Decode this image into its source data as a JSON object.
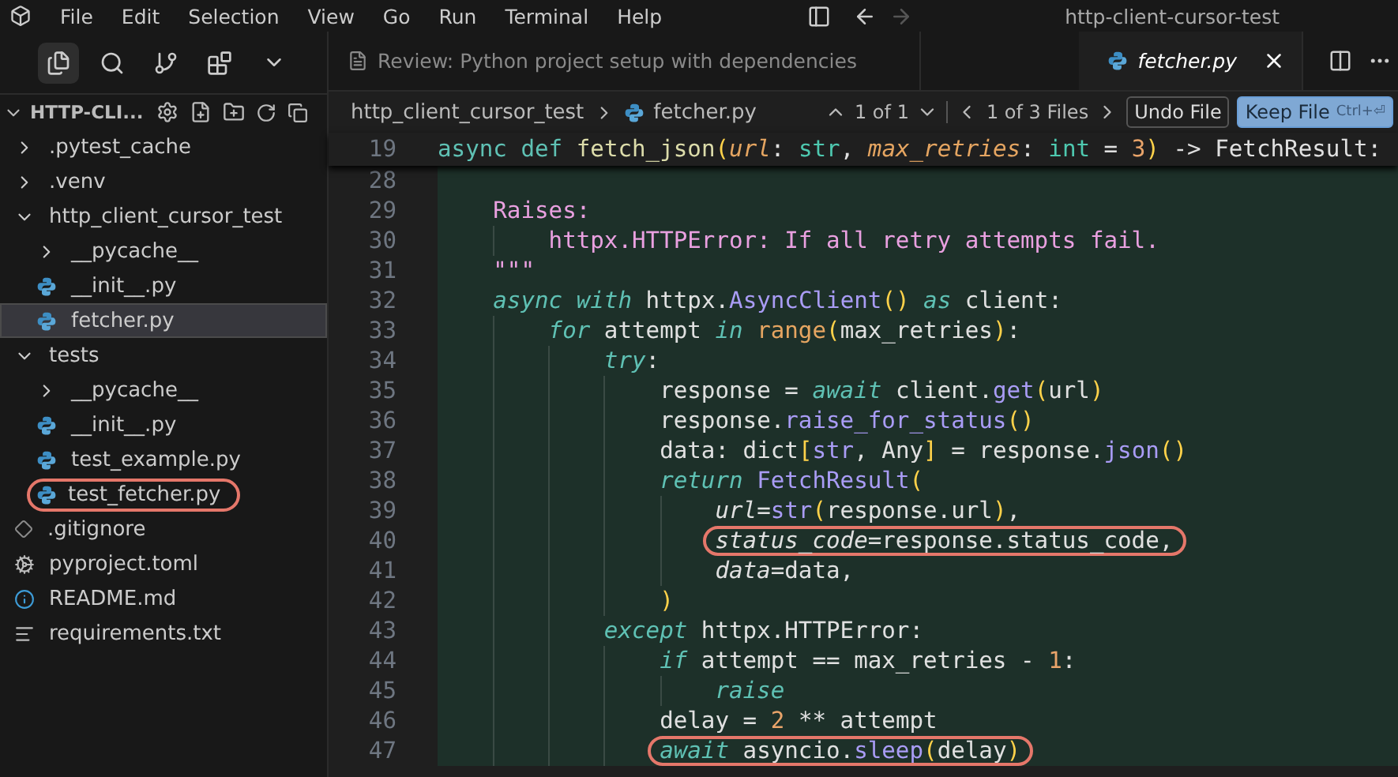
{
  "menu": [
    "File",
    "Edit",
    "Selection",
    "View",
    "Go",
    "Run",
    "Terminal",
    "Help"
  ],
  "window": {
    "title": "http-client-cursor-test"
  },
  "explorer": {
    "title": "HTTP-CLI...",
    "items": [
      {
        "label": ".pytest_cache",
        "kind": "folder",
        "expanded": false,
        "selected": false,
        "circled": false
      },
      {
        "label": ".venv",
        "kind": "folder",
        "expanded": false,
        "selected": false,
        "circled": false
      },
      {
        "label": "http_client_cursor_test",
        "kind": "folder",
        "expanded": true,
        "selected": false,
        "circled": false,
        "children": [
          {
            "label": "__pycache__",
            "kind": "folder",
            "expanded": false,
            "selected": false,
            "circled": false
          },
          {
            "label": "__init__.py",
            "kind": "python",
            "selected": false,
            "circled": false
          },
          {
            "label": "fetcher.py",
            "kind": "python",
            "selected": true,
            "circled": false
          }
        ]
      },
      {
        "label": "tests",
        "kind": "folder",
        "expanded": true,
        "selected": false,
        "circled": false,
        "children": [
          {
            "label": "__pycache__",
            "kind": "folder",
            "expanded": false,
            "selected": false,
            "circled": false
          },
          {
            "label": "__init__.py",
            "kind": "python",
            "selected": false,
            "circled": false
          },
          {
            "label": "test_example.py",
            "kind": "python",
            "selected": false,
            "circled": false
          },
          {
            "label": "test_fetcher.py",
            "kind": "python",
            "selected": false,
            "circled": true
          }
        ]
      },
      {
        "label": ".gitignore",
        "kind": "git",
        "selected": false,
        "circled": false
      },
      {
        "label": "pyproject.toml",
        "kind": "config",
        "selected": false,
        "circled": false
      },
      {
        "label": "README.md",
        "kind": "info",
        "selected": false,
        "circled": false
      },
      {
        "label": "requirements.txt",
        "kind": "text",
        "selected": false,
        "circled": false
      }
    ]
  },
  "tabs": [
    {
      "label": "Review: Python project setup with dependencies",
      "kind": "review",
      "selected": false
    },
    {
      "label": "fetcher.py",
      "kind": "python",
      "selected": true
    }
  ],
  "breadcrumb": [
    "http_client_cursor_test",
    "fetcher.py"
  ],
  "diff_nav": {
    "changes": "1 of 1",
    "files": "1 of 3 Files",
    "undo": "Undo File",
    "keep": "Keep File",
    "keep_shortcut": "Ctrl+⏎"
  },
  "sticky_line": {
    "number": "19",
    "tokens": [
      {
        "kind": "storage",
        "text": "async def "
      },
      {
        "kind": "fn",
        "text": "fetch_json"
      },
      {
        "kind": "paren",
        "text": "("
      },
      {
        "kind": "param",
        "text": "url"
      },
      {
        "kind": "plain",
        "text": ": "
      },
      {
        "kind": "type",
        "text": "str"
      },
      {
        "kind": "plain",
        "text": ", "
      },
      {
        "kind": "param",
        "text": "max_retries"
      },
      {
        "kind": "plain",
        "text": ": "
      },
      {
        "kind": "type",
        "text": "int"
      },
      {
        "kind": "plain",
        "text": " = "
      },
      {
        "kind": "num",
        "text": "3"
      },
      {
        "kind": "paren",
        "text": ")"
      },
      {
        "kind": "plain",
        "text": " -> FetchResult:"
      }
    ]
  },
  "lines": [
    {
      "number": "28"
    },
    {
      "number": "29",
      "circled": false,
      "tokens": [
        {
          "kind": "doc",
          "text": "Raises:"
        }
      ],
      "children": [
        {
          "number": "30",
          "circled": false,
          "tokens": [
            {
              "kind": "doc",
              "text": "httpx.HTTPError: If all retry attempts fail."
            }
          ]
        }
      ]
    },
    {
      "number": "31",
      "circled": false,
      "tokens": [
        {
          "kind": "doc",
          "text": "\"\"\""
        }
      ]
    },
    {
      "number": "32",
      "circled": false,
      "tokens": [
        {
          "kind": "kwi",
          "text": "async with"
        },
        {
          "kind": "plain",
          "text": " httpx."
        },
        {
          "kind": "method",
          "text": "AsyncClient"
        },
        {
          "kind": "paren",
          "text": "() "
        },
        {
          "kind": "kwi",
          "text": "as"
        },
        {
          "kind": "plain",
          "text": " client:"
        }
      ],
      "children": [
        {
          "number": "33",
          "circled": false,
          "tokens": [
            {
              "kind": "kwi",
              "text": "for"
            },
            {
              "kind": "plain",
              "text": " attempt "
            },
            {
              "kind": "kwi",
              "text": "in "
            },
            {
              "kind": "builtin",
              "text": "range"
            },
            {
              "kind": "paren",
              "text": "("
            },
            {
              "kind": "plain",
              "text": "max_retries"
            },
            {
              "kind": "paren",
              "text": ")"
            },
            {
              "kind": "plain",
              "text": ":"
            }
          ],
          "children": [
            {
              "number": "34",
              "circled": false,
              "tokens": [
                {
                  "kind": "kwi",
                  "text": "try"
                },
                {
                  "kind": "plain",
                  "text": ":"
                }
              ],
              "children": [
                {
                  "number": "35",
                  "circled": false,
                  "tokens": [
                    {
                      "kind": "plain",
                      "text": "response = "
                    },
                    {
                      "kind": "kwi",
                      "text": "await"
                    },
                    {
                      "kind": "plain",
                      "text": " client."
                    },
                    {
                      "kind": "method",
                      "text": "get"
                    },
                    {
                      "kind": "paren",
                      "text": "("
                    },
                    {
                      "kind": "plain",
                      "text": "url"
                    },
                    {
                      "kind": "paren",
                      "text": ")"
                    }
                  ]
                },
                {
                  "number": "36",
                  "circled": false,
                  "tokens": [
                    {
                      "kind": "plain",
                      "text": "response."
                    },
                    {
                      "kind": "method",
                      "text": "raise_for_status"
                    },
                    {
                      "kind": "paren",
                      "text": "()"
                    }
                  ]
                },
                {
                  "number": "37",
                  "circled": false,
                  "tokens": [
                    {
                      "kind": "plain",
                      "text": "data: dict"
                    },
                    {
                      "kind": "paren",
                      "text": "["
                    },
                    {
                      "kind": "method",
                      "text": "str"
                    },
                    {
                      "kind": "plain",
                      "text": ", Any"
                    },
                    {
                      "kind": "paren",
                      "text": "]"
                    },
                    {
                      "kind": "plain",
                      "text": " = response."
                    },
                    {
                      "kind": "method",
                      "text": "json"
                    },
                    {
                      "kind": "paren",
                      "text": "()"
                    }
                  ]
                },
                {
                  "number": "38",
                  "circled": false,
                  "tokens": [
                    {
                      "kind": "kwi",
                      "text": "return "
                    },
                    {
                      "kind": "method",
                      "text": "FetchResult"
                    },
                    {
                      "kind": "paren",
                      "text": "("
                    }
                  ],
                  "children": [
                    {
                      "number": "39",
                      "circled": false,
                      "tokens": [
                        {
                          "kind": "arg",
                          "text": "url"
                        },
                        {
                          "kind": "plain",
                          "text": "="
                        },
                        {
                          "kind": "method",
                          "text": "str"
                        },
                        {
                          "kind": "paren",
                          "text": "("
                        },
                        {
                          "kind": "plain",
                          "text": "response.url"
                        },
                        {
                          "kind": "paren",
                          "text": ")"
                        },
                        {
                          "kind": "plain",
                          "text": ","
                        }
                      ]
                    },
                    {
                      "number": "40",
                      "circled": true,
                      "tokens": [
                        {
                          "kind": "arg",
                          "text": "status_code"
                        },
                        {
                          "kind": "plain",
                          "text": "=response.status_code,"
                        }
                      ]
                    },
                    {
                      "number": "41",
                      "circled": false,
                      "tokens": [
                        {
                          "kind": "arg",
                          "text": "data"
                        },
                        {
                          "kind": "plain",
                          "text": "=data,"
                        }
                      ]
                    }
                  ]
                },
                {
                  "number": "42",
                  "circled": false,
                  "tokens": [
                    {
                      "kind": "paren",
                      "text": ")"
                    }
                  ]
                }
              ]
            },
            {
              "number": "43",
              "circled": false,
              "tokens": [
                {
                  "kind": "kwi",
                  "text": "except"
                },
                {
                  "kind": "plain",
                  "text": " httpx.HTTPError:"
                }
              ],
              "children": [
                {
                  "number": "44",
                  "circled": false,
                  "tokens": [
                    {
                      "kind": "kwi",
                      "text": "if"
                    },
                    {
                      "kind": "plain",
                      "text": " attempt == max_retries - "
                    },
                    {
                      "kind": "num",
                      "text": "1"
                    },
                    {
                      "kind": "plain",
                      "text": ":"
                    }
                  ],
                  "children": [
                    {
                      "number": "45",
                      "circled": false,
                      "tokens": [
                        {
                          "kind": "kwi",
                          "text": "raise"
                        }
                      ]
                    }
                  ]
                },
                {
                  "number": "46",
                  "circled": false,
                  "tokens": [
                    {
                      "kind": "plain",
                      "text": "delay = "
                    },
                    {
                      "kind": "num",
                      "text": "2"
                    },
                    {
                      "kind": "plain",
                      "text": " ** attempt"
                    }
                  ]
                },
                {
                  "number": "47",
                  "circled": true,
                  "tokens": [
                    {
                      "kind": "kwi",
                      "text": "await"
                    },
                    {
                      "kind": "plain",
                      "text": " asyncio."
                    },
                    {
                      "kind": "method",
                      "text": "sleep"
                    },
                    {
                      "kind": "paren",
                      "text": "("
                    },
                    {
                      "kind": "plain",
                      "text": "delay"
                    },
                    {
                      "kind": "paren",
                      "text": ")"
                    }
                  ]
                }
              ]
            }
          ]
        }
      ]
    }
  ]
}
